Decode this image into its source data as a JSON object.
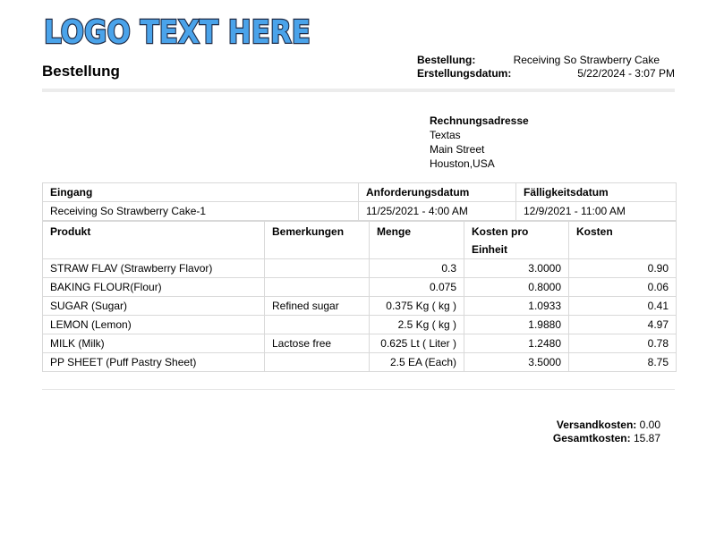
{
  "logo": {
    "text": "LOGO TEXT HERE",
    "fill": "#4aa3ea",
    "stroke": "#1f2a44"
  },
  "header": {
    "title": "Bestellung",
    "order_label": "Bestellung:",
    "order_value": "Receiving So Strawberry Cake",
    "created_label": "Erstellungsdatum:",
    "created_value": "5/22/2024 - 3:07 PM"
  },
  "billing": {
    "heading": "Rechnungsadresse",
    "lines": [
      "Textas",
      "Main Street",
      "Houston,USA"
    ]
  },
  "receiving": {
    "headers": [
      "Eingang",
      "Anforderungsdatum",
      "Fälligkeitsdatum"
    ],
    "values": [
      "Receiving So Strawberry Cake-1",
      "11/25/2021 - 4:00 AM",
      "12/9/2021 - 11:00 AM"
    ]
  },
  "items": {
    "headers": [
      "Produkt",
      "Bemerkungen",
      "Menge",
      "Kosten pro Einheit",
      "Kosten"
    ],
    "rows": [
      [
        "STRAW FLAV (Strawberry Flavor)",
        "",
        "0.3",
        "3.0000",
        "0.90"
      ],
      [
        "BAKING FLOUR(Flour)",
        "",
        "0.075",
        "0.8000",
        "0.06"
      ],
      [
        "SUGAR (Sugar)",
        "Refined sugar",
        "0.375 Kg ( kg )",
        "1.0933",
        "0.41"
      ],
      [
        "LEMON (Lemon)",
        "",
        "2.5 Kg ( kg )",
        "1.9880",
        "4.97"
      ],
      [
        "MILK (Milk)",
        "Lactose free",
        "0.625 Lt ( Liter )",
        "1.2480",
        "0.78"
      ],
      [
        "PP SHEET (Puff Pastry Sheet)",
        "",
        "2.5 EA (Each)",
        "3.5000",
        "8.75"
      ]
    ]
  },
  "totals": {
    "shipping_label": "Versandkosten:",
    "shipping_value": "0.00",
    "total_label": "Gesamtkosten:",
    "total_value": "15.87"
  }
}
